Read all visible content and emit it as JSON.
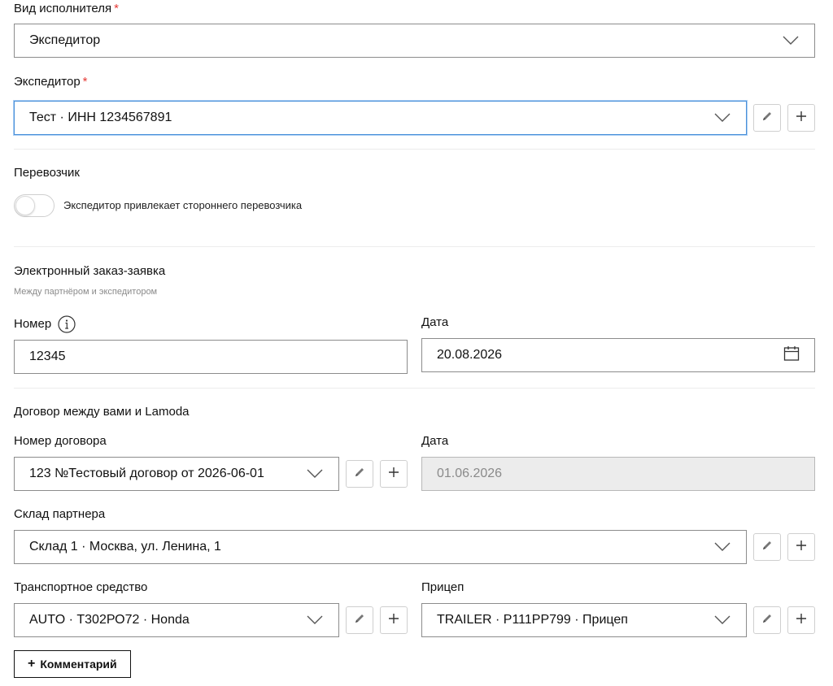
{
  "performer_type": {
    "label": "Вид исполнителя",
    "required": "*",
    "value": "Экспедитор"
  },
  "forwarder": {
    "label": "Экспедитор",
    "required": "*",
    "value": "Тест · ИНН 1234567891"
  },
  "carrier": {
    "title": "Перевозчик",
    "toggle_label": "Экспедитор привлекает стороннего перевозчика",
    "toggle_on": false
  },
  "electronic_order": {
    "title": "Электронный заказ-заявка",
    "hint": "Между партнёром и экспедитором",
    "number_label": "Номер",
    "number_value": "12345",
    "date_label": "Дата",
    "date_value": "20.08.2026"
  },
  "contract": {
    "title": "Договор между вами и Lamoda",
    "number_label": "Номер договора",
    "number_value": "123 №Тестовый договор от 2026-06-01",
    "date_label": "Дата",
    "date_value": "01.06.2026"
  },
  "warehouse": {
    "label": "Склад партнера",
    "value": "Склад 1 · Москва, ул. Ленина, 1"
  },
  "vehicle": {
    "label": "Транспортное средство",
    "value": "AUTO · Т302РО72 · Honda"
  },
  "trailer": {
    "label": "Прицеп",
    "value": "TRAILER · Р111РР799 · Прицеп"
  },
  "comment_button": {
    "plus": "+",
    "label": "Комментарий"
  },
  "icons": {
    "edit": "pencil-icon",
    "add": "plus-icon",
    "dropdown": "chevron-down-icon",
    "calendar": "calendar-icon",
    "info": "info-icon"
  },
  "colors": {
    "required": "#e53935",
    "focus": "#4a90d9",
    "disabled_bg": "#ececec",
    "border": "#8c8c8c"
  }
}
